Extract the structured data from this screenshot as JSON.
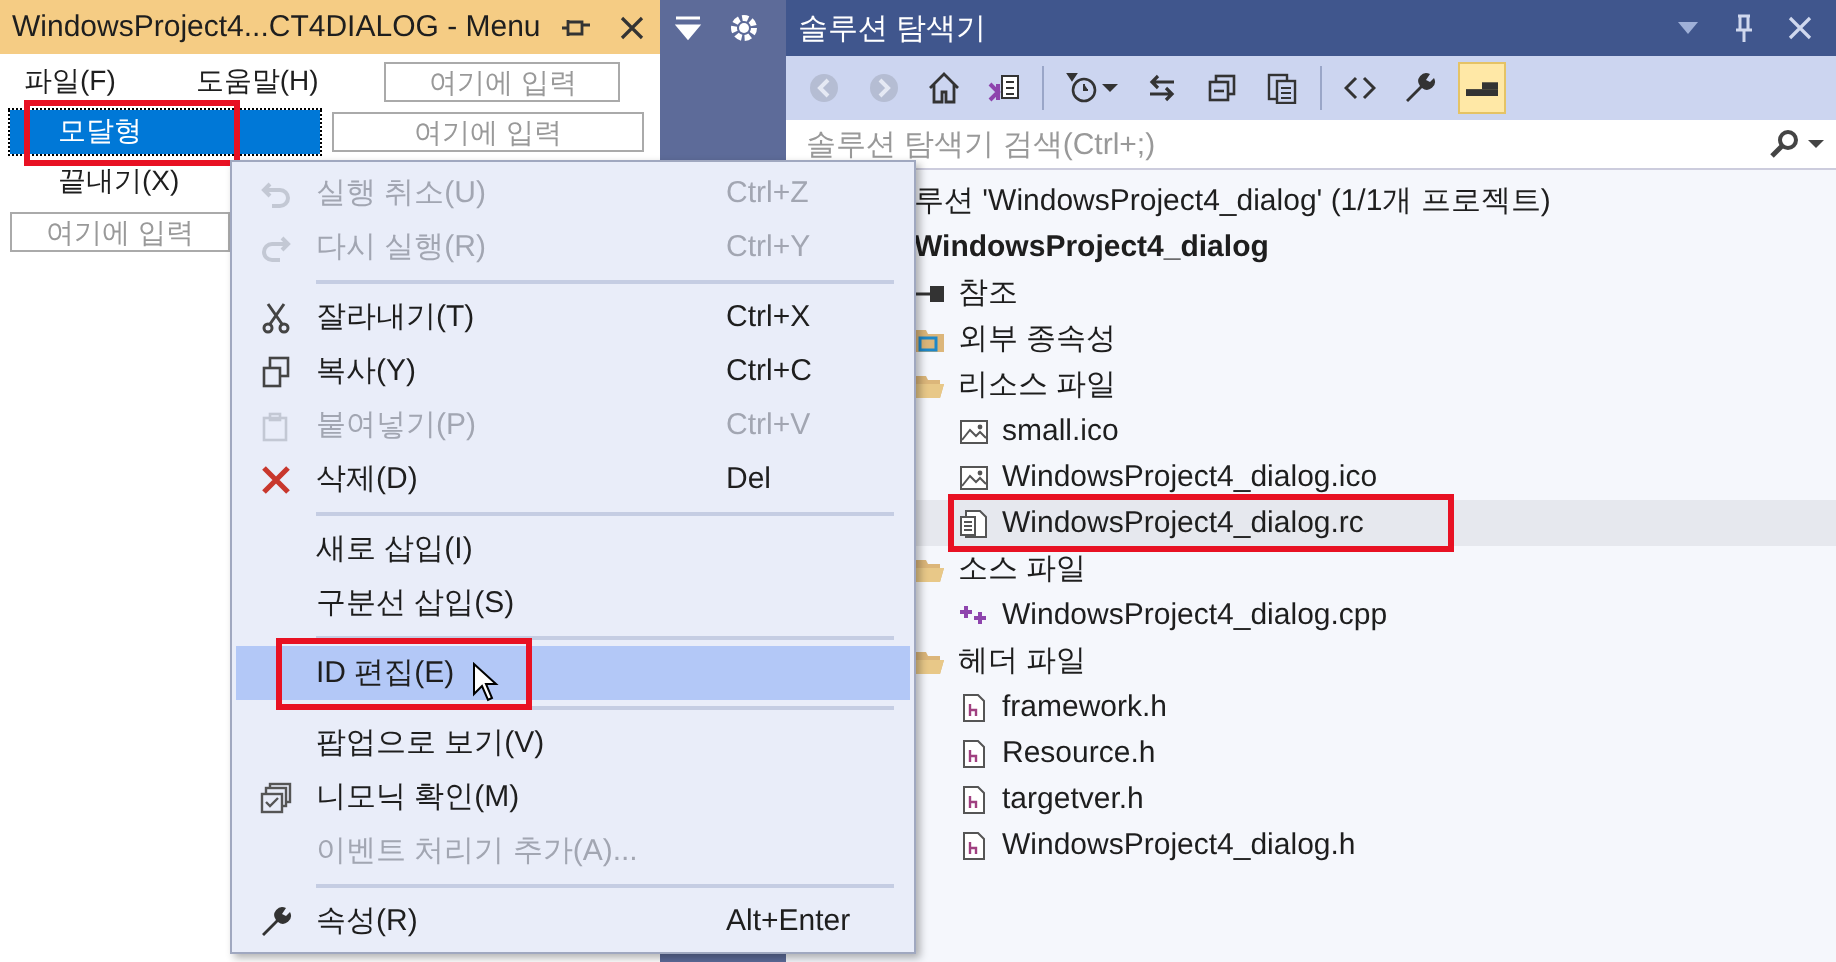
{
  "menu_editor": {
    "title": "WindowsProject4...CT4DIALOG - Menu",
    "menubar": [
      {
        "label": "파일(F)"
      },
      {
        "label": "도움말(H)"
      }
    ],
    "menubar_placeholder": "여기에 입력",
    "items": [
      {
        "label": "모달형",
        "selected": true,
        "marked": true,
        "submenu_placeholder": "여기에 입력"
      },
      {
        "label": "끝내기(X)",
        "selected": false,
        "marked": false
      }
    ],
    "item_placeholder": "여기에 입력"
  },
  "context_menu": [
    {
      "kind": "undo",
      "label": "실행 취소(U)",
      "shortcut": "Ctrl+Z",
      "disabled": true,
      "selected": false,
      "marked": false
    },
    {
      "kind": "redo",
      "label": "다시 실행(R)",
      "shortcut": "Ctrl+Y",
      "disabled": true,
      "selected": false,
      "marked": false
    },
    {
      "kind": "separator"
    },
    {
      "kind": "cut",
      "label": "잘라내기(T)",
      "shortcut": "Ctrl+X",
      "disabled": false,
      "selected": false,
      "marked": false
    },
    {
      "kind": "copy",
      "label": "복사(Y)",
      "shortcut": "Ctrl+C",
      "disabled": false,
      "selected": false,
      "marked": false
    },
    {
      "kind": "paste",
      "label": "붙여넣기(P)",
      "shortcut": "Ctrl+V",
      "disabled": true,
      "selected": false,
      "marked": false
    },
    {
      "kind": "delete",
      "label": "삭제(D)",
      "shortcut": "Del",
      "disabled": false,
      "selected": false,
      "marked": false
    },
    {
      "kind": "separator"
    },
    {
      "kind": "plain",
      "label": "새로 삽입(I)",
      "disabled": false,
      "selected": false,
      "marked": false
    },
    {
      "kind": "plain",
      "label": "구분선 삽입(S)",
      "disabled": false,
      "selected": false,
      "marked": false
    },
    {
      "kind": "separator"
    },
    {
      "kind": "plain",
      "label": "ID 편집(E)",
      "disabled": false,
      "selected": true,
      "marked": true
    },
    {
      "kind": "separator"
    },
    {
      "kind": "plain",
      "label": "팝업으로 보기(V)",
      "disabled": false,
      "selected": false,
      "marked": false
    },
    {
      "kind": "mnemonic",
      "label": "니모닉 확인(M)",
      "disabled": false,
      "selected": false,
      "marked": false
    },
    {
      "kind": "plain",
      "label": "이벤트 처리기 추가(A)...",
      "disabled": true,
      "selected": false,
      "marked": false
    },
    {
      "kind": "separator"
    },
    {
      "kind": "properties",
      "label": "속성(R)",
      "shortcut": "Alt+Enter",
      "disabled": false,
      "selected": false,
      "marked": false
    }
  ],
  "solution_explorer": {
    "title": "솔루션 탐색기",
    "search": {
      "placeholder": "솔루션 탐색기 검색(Ctrl+;)"
    },
    "solution_label": "루션 'WindowsProject4_dialog' (1/1개 프로젝트)",
    "tree": [
      {
        "kind": "project",
        "label": "WindowsProject4_dialog",
        "selected": false,
        "marked": false,
        "children": [
          {
            "kind": "references",
            "label": "참조",
            "selected": false,
            "marked": false
          },
          {
            "kind": "dependencies",
            "label": "외부 종속성",
            "selected": false,
            "marked": false
          },
          {
            "kind": "folder",
            "label": "리소스 파일",
            "selected": false,
            "marked": false,
            "children": [
              {
                "kind": "image",
                "label": "small.ico",
                "selected": false,
                "marked": false
              },
              {
                "kind": "image",
                "label": "WindowsProject4_dialog.ico",
                "selected": false,
                "marked": false
              },
              {
                "kind": "resource",
                "label": "WindowsProject4_dialog.rc",
                "selected": true,
                "marked": true
              }
            ]
          },
          {
            "kind": "folder",
            "label": "소스 파일",
            "selected": false,
            "marked": false,
            "children": [
              {
                "kind": "cpp",
                "label": "WindowsProject4_dialog.cpp",
                "selected": false,
                "marked": false
              }
            ]
          },
          {
            "kind": "folder",
            "label": "헤더 파일",
            "selected": false,
            "marked": false,
            "children": [
              {
                "kind": "header",
                "label": "framework.h",
                "selected": false,
                "marked": false
              },
              {
                "kind": "header",
                "label": "Resource.h",
                "selected": false,
                "marked": false
              },
              {
                "kind": "header",
                "label": "targetver.h",
                "selected": false,
                "marked": false
              },
              {
                "kind": "header",
                "label": "WindowsProject4_dialog.h",
                "selected": false,
                "marked": false
              }
            ]
          }
        ]
      }
    ]
  }
}
